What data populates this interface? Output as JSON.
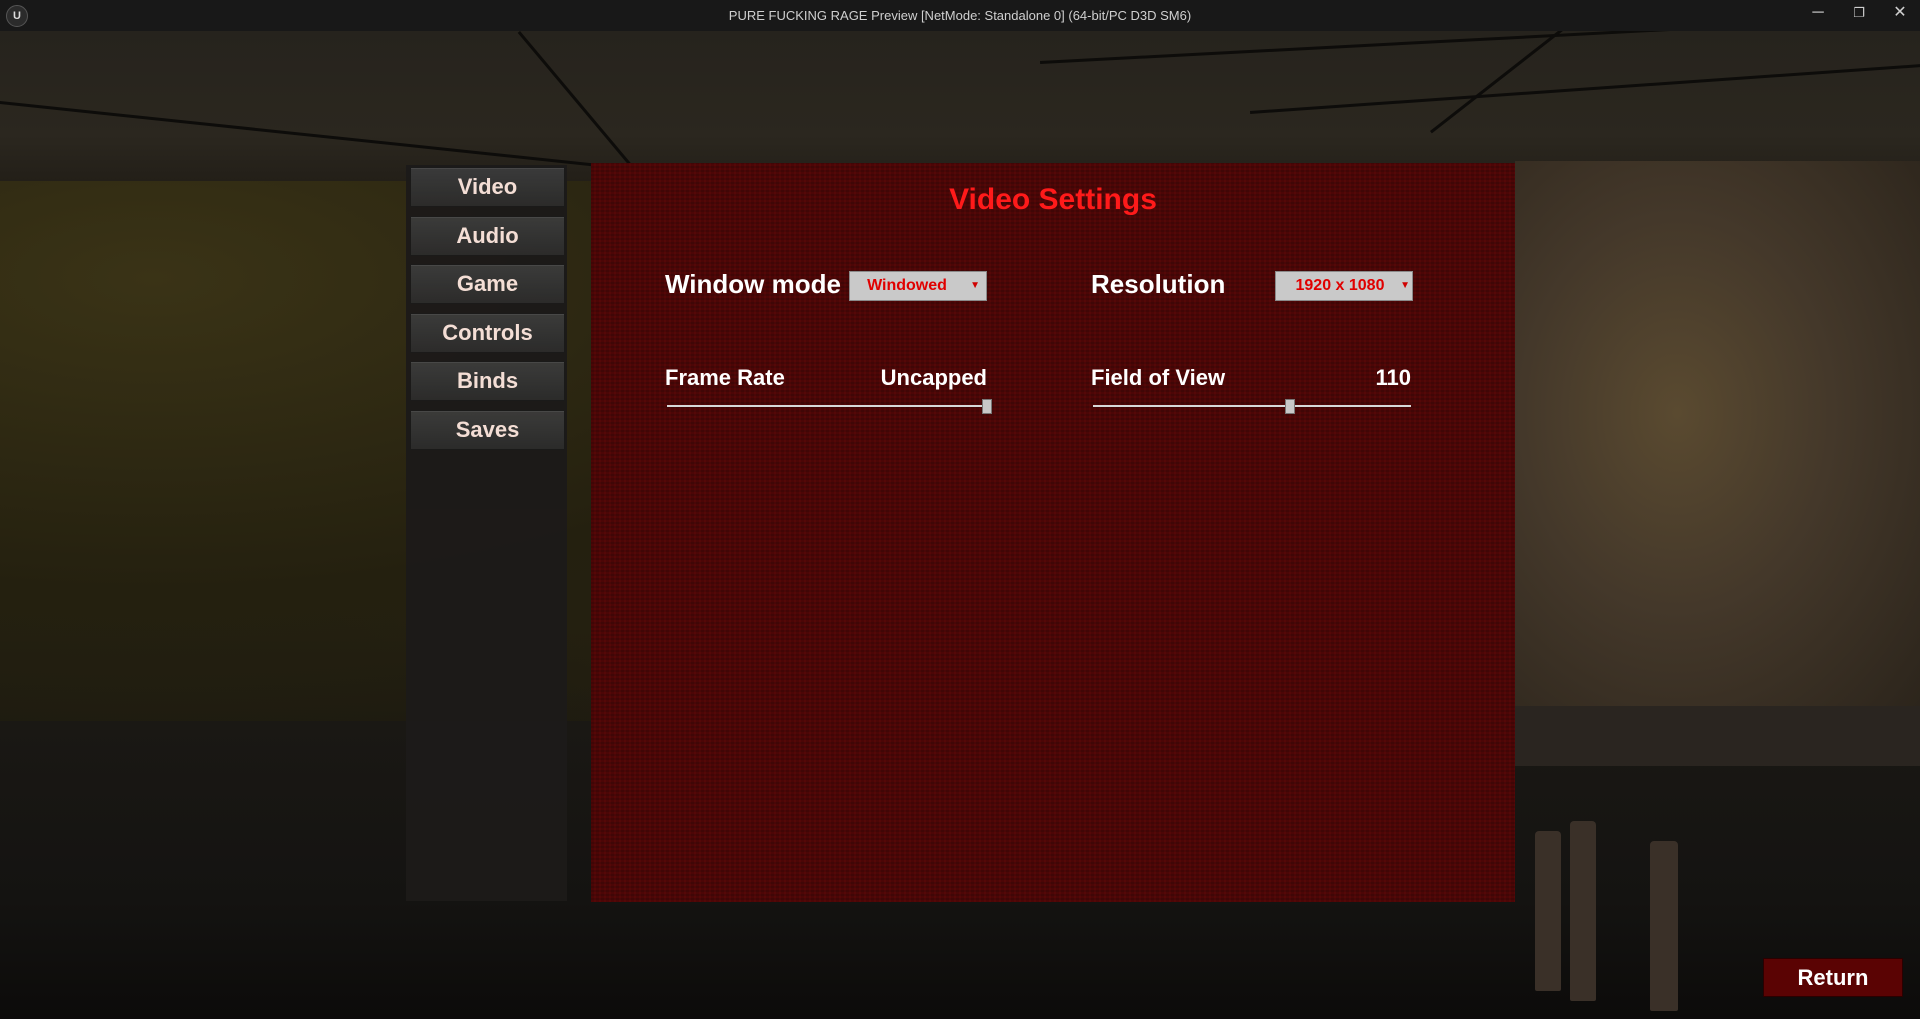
{
  "window": {
    "title": "PURE FUCKING RAGE Preview [NetMode: Standalone 0]  (64-bit/PC D3D SM6)",
    "logo_text": "U",
    "controls": {
      "minimize": "─",
      "maximize": "❐",
      "close": "✕"
    }
  },
  "sidebar": {
    "tabs": [
      {
        "label": "Video"
      },
      {
        "label": "Audio"
      },
      {
        "label": "Game"
      },
      {
        "label": "Controls"
      },
      {
        "label": "Binds"
      },
      {
        "label": "Saves"
      }
    ]
  },
  "video_settings": {
    "title": "Video Settings",
    "window_mode": {
      "label": "Window mode",
      "value": "Windowed"
    },
    "resolution": {
      "label": "Resolution",
      "value": "1920 x 1080"
    },
    "frame_rate": {
      "label": "Frame Rate",
      "value": "Uncapped",
      "level": 1.0
    },
    "field_of_view": {
      "label": "Field of View",
      "value": "110",
      "level": 0.62
    }
  },
  "footer": {
    "return_label": "Return"
  },
  "colors": {
    "accent": "#ff1a1a",
    "panel": "#480606",
    "return_button": "#5a0303"
  }
}
